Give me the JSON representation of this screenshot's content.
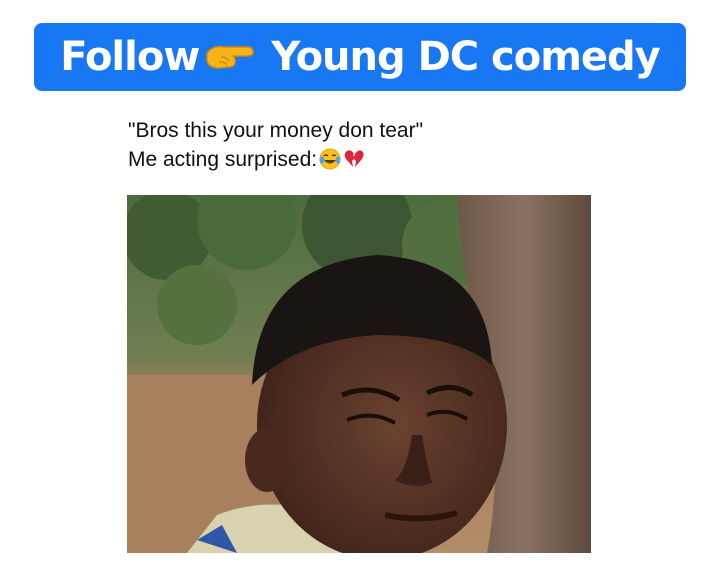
{
  "banner": {
    "follow": "Follow",
    "page_name": "Young DC comedy",
    "background": "#1877f2",
    "icon": "pointing-hand-icon"
  },
  "caption": {
    "line1": "\"Bros this your money don tear\"",
    "line2": "Me acting surprised:",
    "emojis": [
      "tears-of-joy-emoji",
      "broken-heart-emoji"
    ]
  },
  "photo": {
    "subject": "boy-squinting-photo"
  }
}
